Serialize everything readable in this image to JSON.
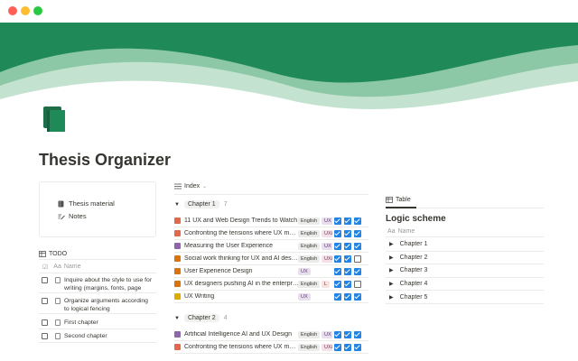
{
  "page": {
    "title": "Thesis Organizer",
    "accent_color": "#1f8a57",
    "icon": "book-icon"
  },
  "links": [
    {
      "label": "Thesis material",
      "icon": "book-icon"
    },
    {
      "label": "Notes",
      "icon": "edit-icon"
    }
  ],
  "todo": {
    "view_label": "TODO",
    "column_header": "Name",
    "items": [
      {
        "text": "Inquire about the style to use for writing (margins, fonts, page numbering)",
        "checked": false
      },
      {
        "text": "Organize arguments according to logical fencing",
        "checked": false
      },
      {
        "text": "First chapter",
        "checked": false
      },
      {
        "text": "Second chapter",
        "checked": false
      }
    ]
  },
  "index": {
    "view_label": "Index",
    "groups": [
      {
        "name": "Chapter 1",
        "count": "7",
        "rows": [
          {
            "title": "11 UX and Web Design Trends to Watch",
            "icon_color": "#e0684b",
            "tags": [
              {
                "label": "English",
                "kind": "en"
              },
              {
                "label": "UX",
                "kind": "ux"
              }
            ],
            "checks": [
              true,
              true,
              true
            ]
          },
          {
            "title": "Confronting the tensions where UX meets AI",
            "icon_color": "#e0684b",
            "tags": [
              {
                "label": "English",
                "kind": "en"
              },
              {
                "label": "UX&A",
                "kind": "uxa"
              }
            ],
            "checks": [
              true,
              true,
              true
            ]
          },
          {
            "title": "Measuring the User Experience",
            "icon_color": "#9065b0",
            "tags": [
              {
                "label": "English",
                "kind": "en"
              },
              {
                "label": "UX",
                "kind": "ux"
              }
            ],
            "checks": [
              true,
              true,
              true
            ]
          },
          {
            "title": "Social work thinking for UX and AI design",
            "icon_color": "#d9730d",
            "tags": [
              {
                "label": "English",
                "kind": "en"
              },
              {
                "label": "UX&A",
                "kind": "uxa"
              },
              {
                "label": "Le",
                "kind": "le"
              }
            ],
            "checks": [
              true,
              true,
              false
            ]
          },
          {
            "title": "User Experience Design",
            "icon_color": "#d9730d",
            "tags": [
              {
                "label": "UX",
                "kind": "ux"
              }
            ],
            "checks": [
              true,
              true,
              true
            ]
          },
          {
            "title": "UX designers pushing AI in the enterprise",
            "icon_color": "#d9730d",
            "tags": [
              {
                "label": "English",
                "kind": "en"
              },
              {
                "label": "L",
                "kind": "le"
              }
            ],
            "checks": [
              true,
              true,
              false
            ]
          },
          {
            "title": "UX Writing",
            "icon_color": "#dfab01",
            "tags": [
              {
                "label": "UX",
                "kind": "ux"
              }
            ],
            "checks": [
              true,
              true,
              true
            ]
          }
        ]
      },
      {
        "name": "Chapter 2",
        "count": "4",
        "rows": [
          {
            "title": "Artificial Intelligence AI and UX Design",
            "icon_color": "#9065b0",
            "tags": [
              {
                "label": "English",
                "kind": "en"
              },
              {
                "label": "UX",
                "kind": "ux"
              }
            ],
            "checks": [
              true,
              true,
              true
            ]
          },
          {
            "title": "Confronting the tensions where UX meets AI",
            "icon_color": "#e0684b",
            "tags": [
              {
                "label": "English",
                "kind": "en"
              },
              {
                "label": "UX&A",
                "kind": "uxa"
              }
            ],
            "checks": [
              true,
              true,
              true
            ]
          }
        ]
      }
    ]
  },
  "logic": {
    "view_label": "Table",
    "title": "Logic scheme",
    "column_header": "Name",
    "rows": [
      "Chapter 1",
      "Chapter 2",
      "Chapter 3",
      "Chapter 4",
      "Chapter 5"
    ]
  }
}
